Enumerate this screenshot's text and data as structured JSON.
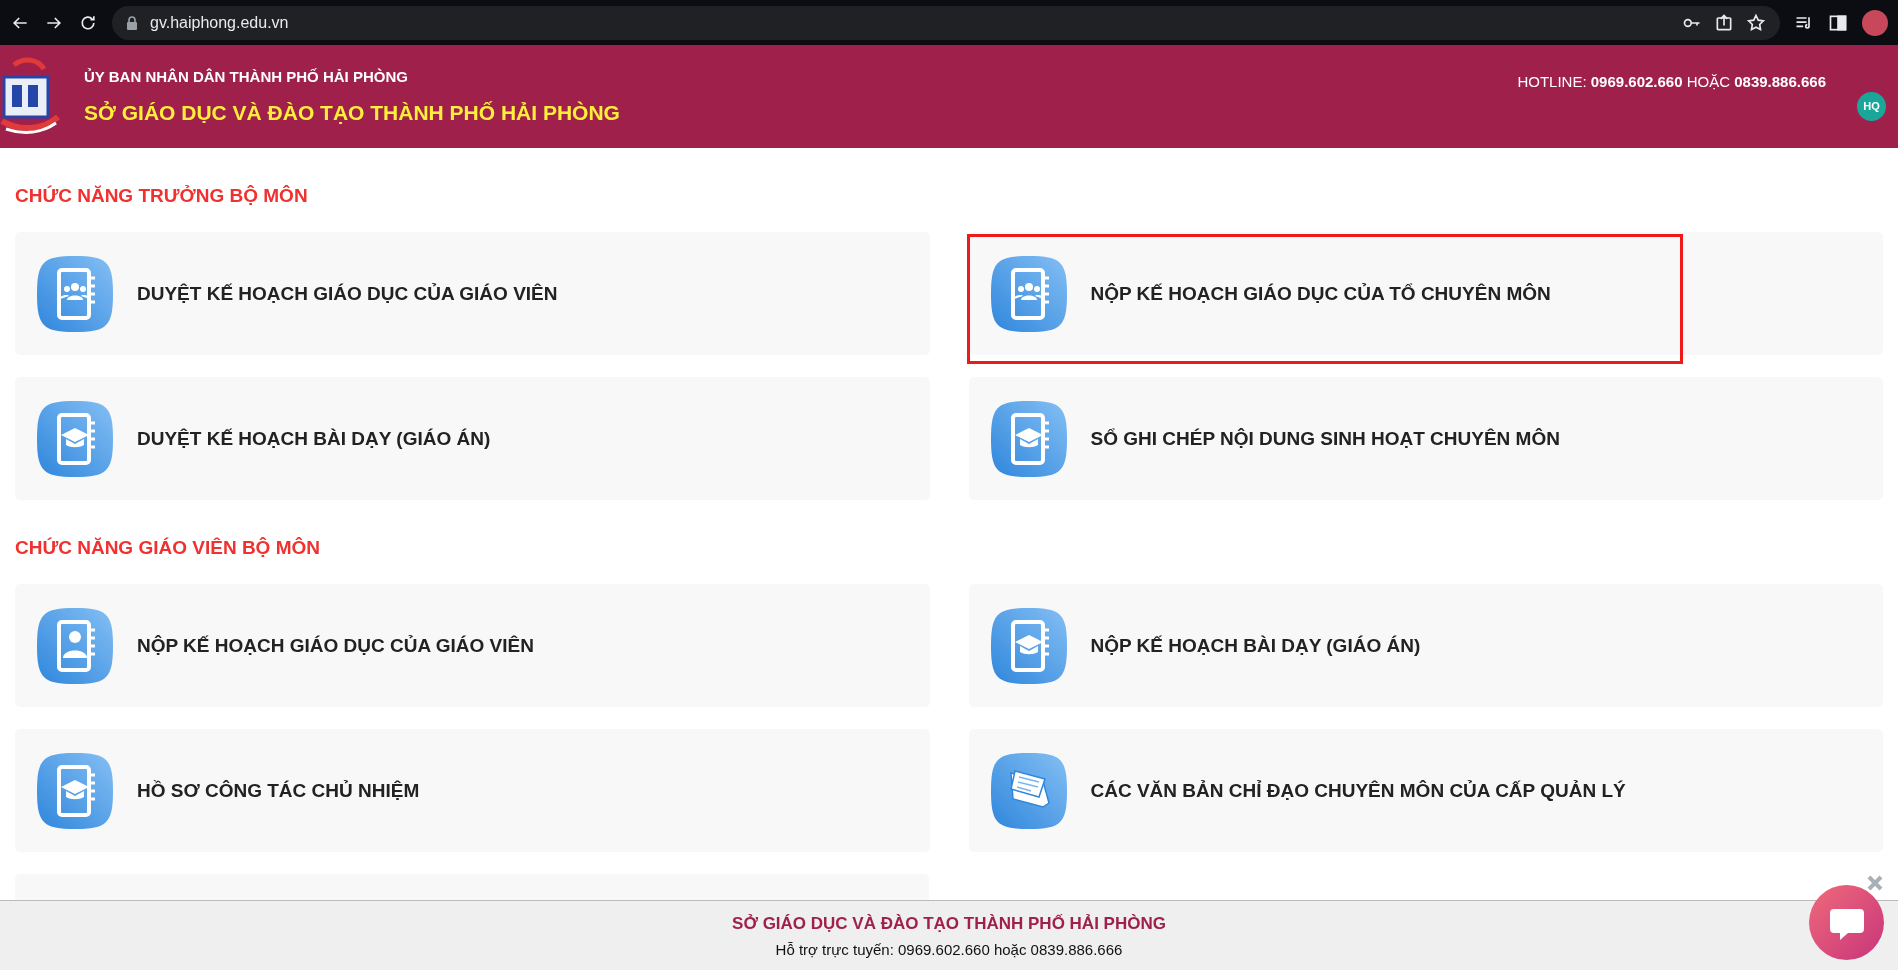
{
  "browser": {
    "url": "gv.haiphong.edu.vn"
  },
  "header": {
    "org": "ỦY BAN NHÂN DÂN THÀNH PHỐ HẢI PHÒNG",
    "title": "SỞ GIÁO DỤC VÀ ĐÀO TẠO THÀNH PHỐ HẢI PHÒNG",
    "hotline": "HOTLINE: **0969.602.660** HOẶC **0839.886.666**",
    "user_initials": "HQ"
  },
  "sections": [
    {
      "title": "CHỨC NĂNG TRƯỞNG BỘ MÔN",
      "items": [
        {
          "label": "DUYỆT KẾ HOẠCH GIÁO DỤC CỦA GIÁO VIÊN",
          "kind": "people",
          "highlighted": false
        },
        {
          "label": "NỘP KẾ HOẠCH GIÁO DỤC CỦA TỔ CHUYÊN MÔN",
          "kind": "people",
          "highlighted": true
        },
        {
          "label": "DUYỆT KẾ HOẠCH BÀI DẠY (GIÁO ÁN)",
          "kind": "cap",
          "highlighted": false
        },
        {
          "label": "SỔ GHI CHÉP NỘI DUNG SINH HOẠT CHUYÊN MÔN",
          "kind": "cap",
          "highlighted": false
        }
      ]
    },
    {
      "title": "CHỨC NĂNG GIÁO VIÊN BỘ MÔN",
      "items": [
        {
          "label": "NỘP KẾ HOẠCH GIÁO DỤC CỦA GIÁO VIÊN",
          "kind": "person",
          "highlighted": false
        },
        {
          "label": "NỘP KẾ HOẠCH BÀI DẠY (GIÁO ÁN)",
          "kind": "cap",
          "highlighted": false
        },
        {
          "label": "HỒ SƠ CÔNG TÁC CHỦ NHIỆM",
          "kind": "cap",
          "highlighted": false
        },
        {
          "label": "CÁC VĂN BẢN CHỈ ĐẠO CHUYÊN MÔN CỦA CẤP QUẢN LÝ",
          "kind": "papers",
          "highlighted": false
        }
      ]
    }
  ],
  "footer": {
    "title": "SỞ GIÁO DỤC VÀ ĐÀO TẠO THÀNH PHỐ HẢI PHÒNG",
    "support": "Hỗ trợ trực tuyến: 0969.602.660 hoặc 0839.886.666"
  }
}
